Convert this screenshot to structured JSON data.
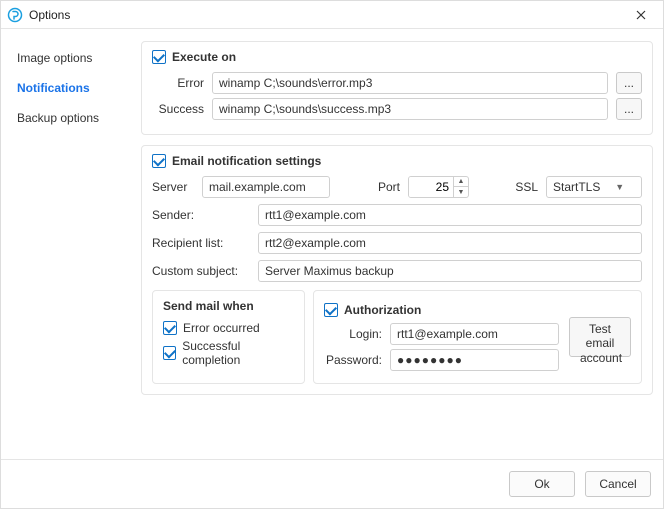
{
  "window": {
    "title": "Options"
  },
  "sidebar": {
    "items": [
      {
        "label": "Image options"
      },
      {
        "label": "Notifications"
      },
      {
        "label": "Backup options"
      }
    ],
    "active_index": 1
  },
  "execute": {
    "section": "Execute on",
    "error_label": "Error",
    "error_value": "winamp C;\\sounds\\error.mp3",
    "success_label": "Success",
    "success_value": "winamp C;\\sounds\\success.mp3",
    "browse": "..."
  },
  "email": {
    "section": "Email notification settings",
    "server_label": "Server",
    "server_value": "mail.example.com",
    "port_label": "Port",
    "port_value": "25",
    "ssl_label": "SSL",
    "ssl_value": "StartTLS",
    "sender_label": "Sender:",
    "sender_value": "rtt1@example.com",
    "recipient_label": "Recipient list:",
    "recipient_value": "rtt2@example.com",
    "subject_label": "Custom subject:",
    "subject_value": "Server Maximus backup"
  },
  "send_when": {
    "section": "Send mail when",
    "error_label": "Error occurred",
    "success_label": "Successful completion"
  },
  "auth": {
    "section": "Authorization",
    "login_label": "Login:",
    "login_value": "rtt1@example.com",
    "password_label": "Password:",
    "password_mask": "●●●●●●●●",
    "test_label": "Test email account"
  },
  "footer": {
    "ok": "Ok",
    "cancel": "Cancel"
  }
}
